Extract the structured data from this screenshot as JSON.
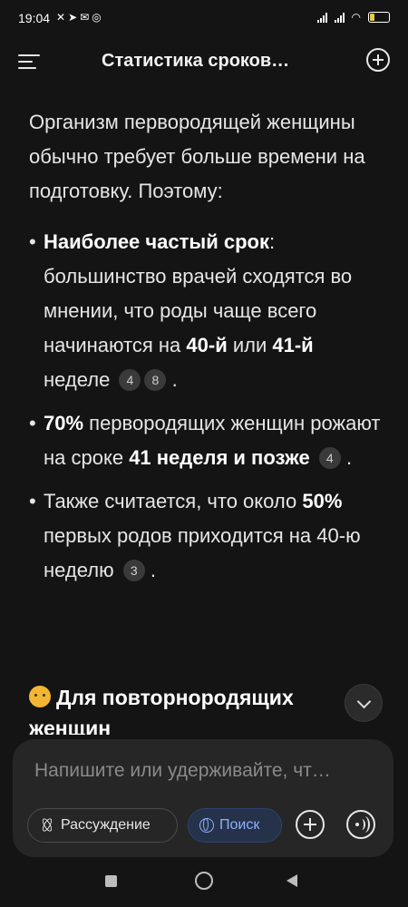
{
  "status_bar": {
    "time": "19:04",
    "left_icons": [
      "muted-icon",
      "telegram-icon",
      "mail-icon",
      "instagram-icon"
    ],
    "battery": "27",
    "battery_level": 0.27,
    "battery_color": "#e3c94a"
  },
  "header": {
    "title": "Статистика сроков…"
  },
  "content": {
    "intro": "Организм первородящей женщины обычно требует больше времени на подготовку. Поэтому:",
    "bullets": [
      {
        "bold1": "Наиболее частый срок",
        "text1": ": большинство врачей сходятся во мнении, что роды чаще всего начинаются на ",
        "bold2": "40-й",
        "text2": " или ",
        "bold3": "41-й",
        "text3": " неделе",
        "cites": [
          "4",
          "8"
        ],
        "end": "."
      },
      {
        "bold1": "70%",
        "text1": " первородящих женщин рожают на сроке ",
        "bold2": "41 неделя и позже",
        "cites": [
          "4"
        ],
        "end": "."
      },
      {
        "text1": "Также считается, что около ",
        "bold1": "50%",
        "text2": " первых родов приходится на 40-ю неделю",
        "cites": [
          "3"
        ],
        "end": "."
      }
    ],
    "section_title": "Для повторнородящих женщин"
  },
  "composer": {
    "placeholder": "Напишите или удерживайте, чт…",
    "reason_label": "Рассуждение",
    "search_label": "Поиск",
    "search_color": "#8fb0ff"
  }
}
